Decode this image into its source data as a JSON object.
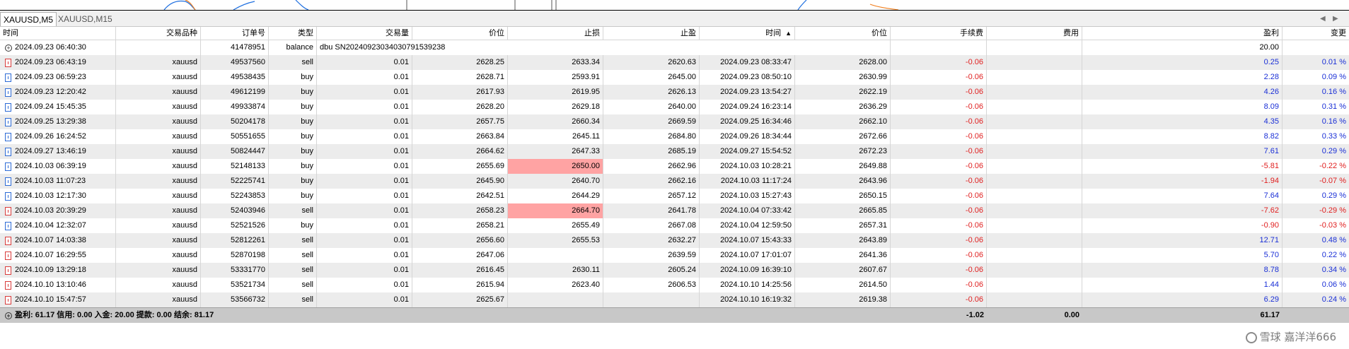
{
  "tabs": [
    {
      "label": "XAUUSD,M5",
      "active": true
    },
    {
      "label": "XAUUSD,M15",
      "active": false
    }
  ],
  "columns": {
    "time": "时间",
    "symbol": "交易品种",
    "order": "订单号",
    "type": "类型",
    "volume": "交易量",
    "price": "价位",
    "sl": "止损",
    "tp": "止盈",
    "close_time": "时间",
    "close_price": "价位",
    "commission": "手续费",
    "fee": "费用",
    "profit": "盈利",
    "change": "变更"
  },
  "sort_indicator": "▲",
  "balance_row": {
    "time": "2024.09.23 06:40:30",
    "order": "41478951",
    "type": "balance",
    "comment": "dbu SN20240923034030791539238",
    "profit": "20.00"
  },
  "rows": [
    {
      "time": "2024.09.23 06:43:19",
      "symbol": "xauusd",
      "order": "49537560",
      "type": "sell",
      "volume": "0.01",
      "price": "2628.25",
      "sl": "2633.34",
      "tp": "2620.63",
      "close_time": "2024.09.23 08:33:47",
      "close_price": "2628.00",
      "commission": "-0.06",
      "profit": "0.25",
      "change": "0.01 %",
      "sl_hit": false
    },
    {
      "time": "2024.09.23 06:59:23",
      "symbol": "xauusd",
      "order": "49538435",
      "type": "buy",
      "volume": "0.01",
      "price": "2628.71",
      "sl": "2593.91",
      "tp": "2645.00",
      "close_time": "2024.09.23 08:50:10",
      "close_price": "2630.99",
      "commission": "-0.06",
      "profit": "2.28",
      "change": "0.09 %",
      "sl_hit": false
    },
    {
      "time": "2024.09.23 12:20:42",
      "symbol": "xauusd",
      "order": "49612199",
      "type": "buy",
      "volume": "0.01",
      "price": "2617.93",
      "sl": "2619.95",
      "tp": "2626.13",
      "close_time": "2024.09.23 13:54:27",
      "close_price": "2622.19",
      "commission": "-0.06",
      "profit": "4.26",
      "change": "0.16 %",
      "sl_hit": false
    },
    {
      "time": "2024.09.24 15:45:35",
      "symbol": "xauusd",
      "order": "49933874",
      "type": "buy",
      "volume": "0.01",
      "price": "2628.20",
      "sl": "2629.18",
      "tp": "2640.00",
      "close_time": "2024.09.24 16:23:14",
      "close_price": "2636.29",
      "commission": "-0.06",
      "profit": "8.09",
      "change": "0.31 %",
      "sl_hit": false
    },
    {
      "time": "2024.09.25 13:29:38",
      "symbol": "xauusd",
      "order": "50204178",
      "type": "buy",
      "volume": "0.01",
      "price": "2657.75",
      "sl": "2660.34",
      "tp": "2669.59",
      "close_time": "2024.09.25 16:34:46",
      "close_price": "2662.10",
      "commission": "-0.06",
      "profit": "4.35",
      "change": "0.16 %",
      "sl_hit": false
    },
    {
      "time": "2024.09.26 16:24:52",
      "symbol": "xauusd",
      "order": "50551655",
      "type": "buy",
      "volume": "0.01",
      "price": "2663.84",
      "sl": "2645.11",
      "tp": "2684.80",
      "close_time": "2024.09.26 18:34:44",
      "close_price": "2672.66",
      "commission": "-0.06",
      "profit": "8.82",
      "change": "0.33 %",
      "sl_hit": false
    },
    {
      "time": "2024.09.27 13:46:19",
      "symbol": "xauusd",
      "order": "50824447",
      "type": "buy",
      "volume": "0.01",
      "price": "2664.62",
      "sl": "2647.33",
      "tp": "2685.19",
      "close_time": "2024.09.27 15:54:52",
      "close_price": "2672.23",
      "commission": "-0.06",
      "profit": "7.61",
      "change": "0.29 %",
      "sl_hit": false
    },
    {
      "time": "2024.10.03 06:39:19",
      "symbol": "xauusd",
      "order": "52148133",
      "type": "buy",
      "volume": "0.01",
      "price": "2655.69",
      "sl": "2650.00",
      "tp": "2662.96",
      "close_time": "2024.10.03 10:28:21",
      "close_price": "2649.88",
      "commission": "-0.06",
      "profit": "-5.81",
      "change": "-0.22 %",
      "sl_hit": true
    },
    {
      "time": "2024.10.03 11:07:23",
      "symbol": "xauusd",
      "order": "52225741",
      "type": "buy",
      "volume": "0.01",
      "price": "2645.90",
      "sl": "2640.70",
      "tp": "2662.16",
      "close_time": "2024.10.03 11:17:24",
      "close_price": "2643.96",
      "commission": "-0.06",
      "profit": "-1.94",
      "change": "-0.07 %",
      "sl_hit": false
    },
    {
      "time": "2024.10.03 12:17:30",
      "symbol": "xauusd",
      "order": "52243853",
      "type": "buy",
      "volume": "0.01",
      "price": "2642.51",
      "sl": "2644.29",
      "tp": "2657.12",
      "close_time": "2024.10.03 15:27:43",
      "close_price": "2650.15",
      "commission": "-0.06",
      "profit": "7.64",
      "change": "0.29 %",
      "sl_hit": false
    },
    {
      "time": "2024.10.03 20:39:29",
      "symbol": "xauusd",
      "order": "52403946",
      "type": "sell",
      "volume": "0.01",
      "price": "2658.23",
      "sl": "2664.70",
      "tp": "2641.78",
      "close_time": "2024.10.04 07:33:42",
      "close_price": "2665.85",
      "commission": "-0.06",
      "profit": "-7.62",
      "change": "-0.29 %",
      "sl_hit": true
    },
    {
      "time": "2024.10.04 12:32:07",
      "symbol": "xauusd",
      "order": "52521526",
      "type": "buy",
      "volume": "0.01",
      "price": "2658.21",
      "sl": "2655.49",
      "tp": "2667.08",
      "close_time": "2024.10.04 12:59:50",
      "close_price": "2657.31",
      "commission": "-0.06",
      "profit": "-0.90",
      "change": "-0.03 %",
      "sl_hit": false
    },
    {
      "time": "2024.10.07 14:03:38",
      "symbol": "xauusd",
      "order": "52812261",
      "type": "sell",
      "volume": "0.01",
      "price": "2656.60",
      "sl": "2655.53",
      "tp": "2632.27",
      "close_time": "2024.10.07 15:43:33",
      "close_price": "2643.89",
      "commission": "-0.06",
      "profit": "12.71",
      "change": "0.48 %",
      "sl_hit": false
    },
    {
      "time": "2024.10.07 16:29:55",
      "symbol": "xauusd",
      "order": "52870198",
      "type": "sell",
      "volume": "0.01",
      "price": "2647.06",
      "sl": "",
      "tp": "2639.59",
      "close_time": "2024.10.07 17:01:07",
      "close_price": "2641.36",
      "commission": "-0.06",
      "profit": "5.70",
      "change": "0.22 %",
      "sl_hit": false
    },
    {
      "time": "2024.10.09 13:29:18",
      "symbol": "xauusd",
      "order": "53331770",
      "type": "sell",
      "volume": "0.01",
      "price": "2616.45",
      "sl": "2630.11",
      "tp": "2605.24",
      "close_time": "2024.10.09 16:39:10",
      "close_price": "2607.67",
      "commission": "-0.06",
      "profit": "8.78",
      "change": "0.34 %",
      "sl_hit": false
    },
    {
      "time": "2024.10.10 13:10:46",
      "symbol": "xauusd",
      "order": "53521734",
      "type": "sell",
      "volume": "0.01",
      "price": "2615.94",
      "sl": "2623.40",
      "tp": "2606.53",
      "close_time": "2024.10.10 14:25:56",
      "close_price": "2614.50",
      "commission": "-0.06",
      "profit": "1.44",
      "change": "0.06 %",
      "sl_hit": false
    },
    {
      "time": "2024.10.10 15:47:57",
      "symbol": "xauusd",
      "order": "53566732",
      "type": "sell",
      "volume": "0.01",
      "price": "2625.67",
      "sl": "",
      "tp": "",
      "close_time": "2024.10.10 16:19:32",
      "close_price": "2619.38",
      "commission": "-0.06",
      "profit": "6.29",
      "change": "0.24 %",
      "sl_hit": false
    }
  ],
  "summary": {
    "text": "盈利: 61.17  信用: 0.00  入金: 20.00  提款: 0.00  结余: 81.17",
    "commission_total": "-1.02",
    "fee_total": "0.00",
    "profit_total": "61.17"
  },
  "watermark": "雪球 嘉洋洋666",
  "colors": {
    "negative": "#e02020",
    "positive": "#1a2fd6",
    "sl_highlight": "#ffa3a3",
    "alt_row": "#ececec",
    "summary_bar": "#c8c8c8"
  }
}
